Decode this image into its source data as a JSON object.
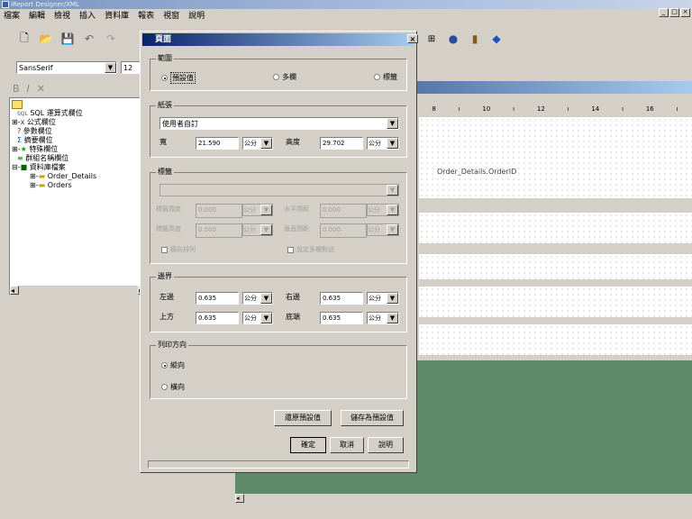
{
  "app": {
    "title": "iReport Designer/XML"
  },
  "menu": [
    "檔案",
    "編輯",
    "檢視",
    "插入",
    "資料庫",
    "報表",
    "視窗",
    "說明"
  ],
  "toolbar": {
    "font_name": "SansSerif",
    "font_size": "12"
  },
  "tree": {
    "items": [
      "SQL 運算式欄位",
      "公式欄位",
      "參數欄位",
      "摘要欄位",
      "特殊欄位",
      "群組名稱欄位",
      "資料庫檔案",
      "Order_Details",
      "Orders"
    ],
    "sql_prefix": "SQL"
  },
  "ruler": {
    "labels": [
      "8",
      "10",
      "12",
      "14",
      "16"
    ]
  },
  "canvas": {
    "field_label": "Order_Details.OrderID"
  },
  "dialog": {
    "title": "頁面",
    "scope": {
      "legend": "範圍",
      "options": [
        "預設值",
        "多欄",
        "標籤"
      ],
      "selected": 0
    },
    "paper": {
      "legend": "紙張",
      "type": "使用者自訂",
      "width_label": "寬",
      "width": "21.590",
      "width_unit": "公分",
      "height_label": "高度",
      "height": "29.702",
      "height_unit": "公分"
    },
    "label": {
      "legend": "標籤",
      "label_width": "標籤寬度",
      "label_width_val": "0.000",
      "h_gap": "水平間距",
      "h_gap_val": "0.000",
      "label_height": "標籤高度",
      "label_height_val": "0.000",
      "v_gap": "垂直間距",
      "v_gap_val": "0.000",
      "unit": "公分",
      "check1": "橫向排列",
      "check2": "設定多欄對話"
    },
    "margins": {
      "legend": "邊界",
      "left_label": "左邊",
      "left": "0.635",
      "right_label": "右邊",
      "right": "0.635",
      "top_label": "上方",
      "top": "0.635",
      "bottom_label": "底端",
      "bottom": "0.635",
      "unit": "公分"
    },
    "orientation": {
      "legend": "列印方向",
      "options": [
        "縱向",
        "橫向"
      ],
      "selected": 0
    },
    "buttons": {
      "restore": "還原預設值",
      "save": "儲存為預設值",
      "ok": "確定",
      "cancel": "取消",
      "help": "說明"
    }
  }
}
